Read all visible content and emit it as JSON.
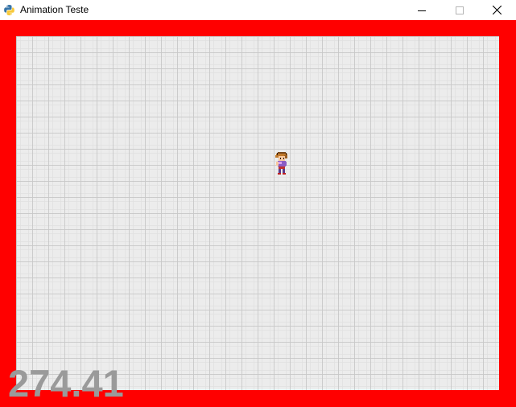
{
  "window": {
    "title": "Animation Teste",
    "app_icon": "python-icon",
    "controls": {
      "minimize_icon": "minimize-icon",
      "maximize_icon": "maximize-icon",
      "close_icon": "close-icon"
    }
  },
  "game": {
    "border_color": "#ff0000",
    "floor_color": "#ececec",
    "grid_line_color": "#c8c8c8",
    "character_sprite": "character-sprite",
    "fps_value": "274.41",
    "fps_color": "#9a9a9a"
  }
}
